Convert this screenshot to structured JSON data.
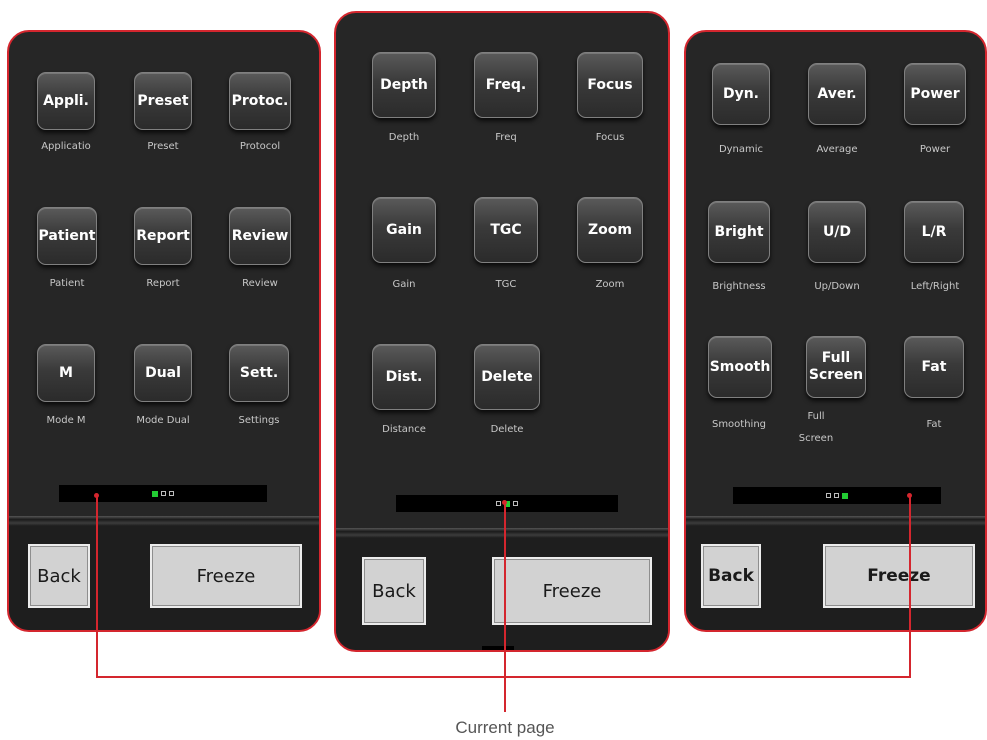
{
  "panels": [
    {
      "tiles": [
        {
          "label": "Appli.",
          "caption": "Applicatio"
        },
        {
          "label": "Preset",
          "caption": "Preset"
        },
        {
          "label": "Protoc.",
          "caption": "Protocol"
        },
        {
          "label": "Patient",
          "caption": "Patient"
        },
        {
          "label": "Report",
          "caption": "Report"
        },
        {
          "label": "Review",
          "caption": "Review"
        },
        {
          "label": "M",
          "caption": "Mode M"
        },
        {
          "label": "Dual",
          "caption": "Mode Dual"
        },
        {
          "label": "Sett.",
          "caption": "Settings"
        }
      ],
      "pager": {
        "count": 3,
        "active": 0
      },
      "back_label": "Back",
      "freeze_label": "Freeze"
    },
    {
      "tiles": [
        {
          "label": "Depth",
          "caption": "Depth"
        },
        {
          "label": "Freq.",
          "caption": "Freq"
        },
        {
          "label": "Focus",
          "caption": "Focus"
        },
        {
          "label": "Gain",
          "caption": "Gain"
        },
        {
          "label": "TGC",
          "caption": "TGC"
        },
        {
          "label": "Zoom",
          "caption": "Zoom"
        },
        {
          "label": "Dist.",
          "caption": "Distance"
        },
        {
          "label": "Delete",
          "caption": "Delete"
        }
      ],
      "pager": {
        "count": 3,
        "active": 1
      },
      "back_label": "Back",
      "freeze_label": "Freeze"
    },
    {
      "tiles": [
        {
          "label": "Dyn.",
          "caption": "Dynamic"
        },
        {
          "label": "Aver.",
          "caption": "Average"
        },
        {
          "label": "Power",
          "caption": "Power"
        },
        {
          "label": "Bright",
          "caption": "Brightness"
        },
        {
          "label": "U/D",
          "caption": "Up/Down"
        },
        {
          "label": "L/R",
          "caption": "Left/Right"
        },
        {
          "label": "Smooth",
          "caption": "Smoothing"
        },
        {
          "label": "Full\nScreen",
          "caption": "Full\nScreen"
        },
        {
          "label": "Fat",
          "caption": "Fat"
        }
      ],
      "pager": {
        "count": 3,
        "active": 2
      },
      "back_label": "Back",
      "freeze_label": "Freeze"
    }
  ],
  "annotation": {
    "current_page": "Current page"
  },
  "colors": {
    "accent_red": "#d4262e",
    "pager_active": "#22cc33",
    "panel_bg": "#262626"
  }
}
